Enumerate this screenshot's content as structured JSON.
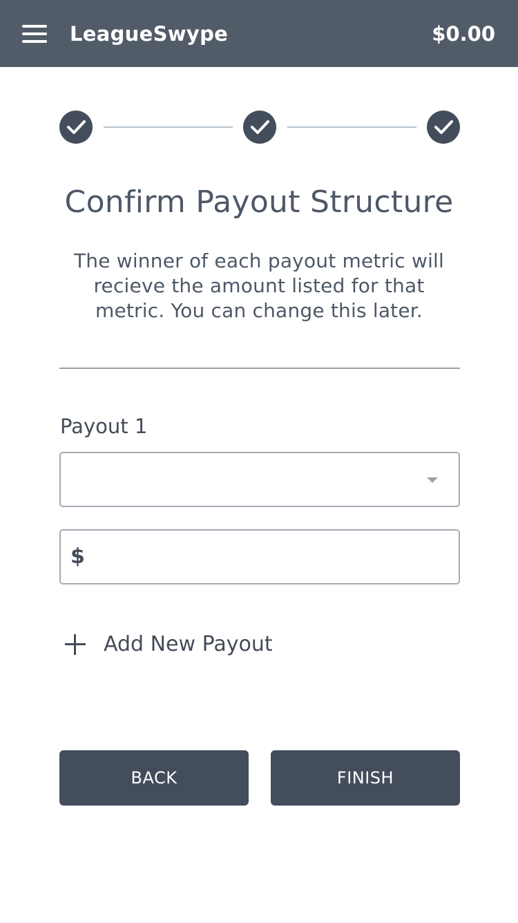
{
  "header": {
    "app_title": "LeagueSwype",
    "balance": "$0.00",
    "menu_icon": "hamburger-menu-icon"
  },
  "progress": {
    "steps": [
      {
        "status": "complete",
        "icon": "checkmark-icon"
      },
      {
        "status": "complete",
        "icon": "checkmark-icon"
      },
      {
        "status": "complete",
        "icon": "checkmark-icon"
      }
    ],
    "completed": 3,
    "total": 3
  },
  "main": {
    "title": "Confirm Payout Structure",
    "description": "The winner of each payout metric will recieve the amount listed for that metric. You can change this later.",
    "payouts": [
      {
        "label": "Payout 1",
        "metric_selected": "",
        "amount_prefix": "$",
        "amount_value": ""
      }
    ],
    "add_payout_label": "Add New Payout"
  },
  "actions": {
    "back_label": "BACK",
    "finish_label": "FINISH"
  },
  "colors": {
    "header_bg": "#525c69",
    "button_bg": "#444d5c",
    "text": "#4d5867",
    "border": "#a4abb4"
  }
}
